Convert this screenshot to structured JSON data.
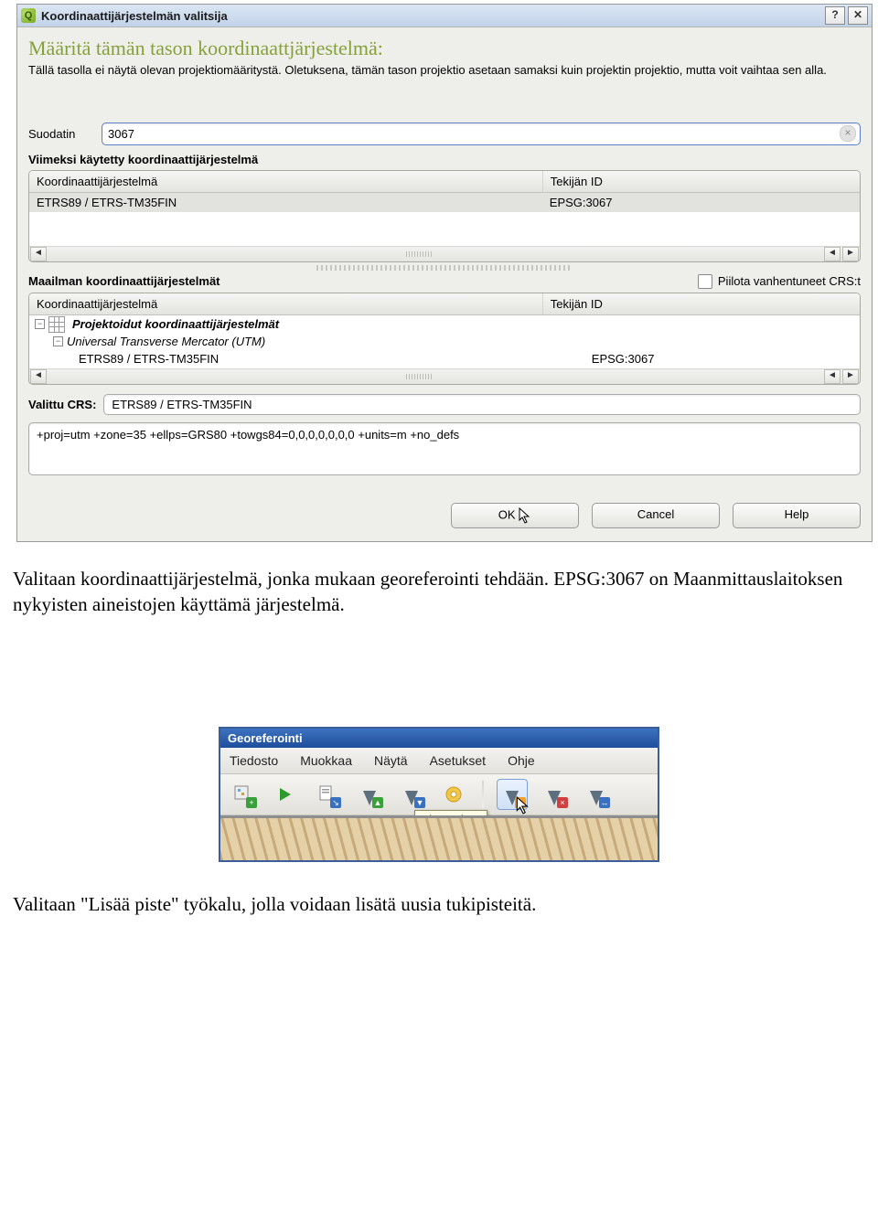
{
  "dialog": {
    "title": "Koordinaattijärjestelmän valitsija",
    "header_title": "Määritä tämän tason koordinaattjärjestelmä:",
    "header_desc": "Tällä tasolla ei näytä olevan projektiomääritystä. Oletuksena, tämän tason projektio asetaan samaksi kuin projektin projektio, mutta voit vaihtaa sen alla.",
    "filter_label": "Suodatin",
    "filter_value": "3067",
    "recent_label": "Viimeksi käytetty koordinaattijärjestelmä",
    "col_crs": "Koordinaattijärjestelmä",
    "col_id": "Tekijän ID",
    "recent_rows": [
      {
        "crs": "ETRS89 / ETRS-TM35FIN",
        "id": "EPSG:3067"
      }
    ],
    "world_label": "Maailman koordinaattijärjestelmät",
    "hide_dep_label": "Piilota vanhentuneet CRS:t",
    "tree": {
      "group1": "Projektoidut koordinaattijärjestelmät",
      "group2": "Universal Transverse Mercator (UTM)",
      "leaf_crs": "ETRS89 / ETRS-TM35FIN",
      "leaf_id": "EPSG:3067"
    },
    "selected_label": "Valittu CRS:",
    "selected_value": "ETRS89 / ETRS-TM35FIN",
    "proj_string": "+proj=utm +zone=35 +ellps=GRS80 +towgs84=0,0,0,0,0,0,0 +units=m +no_defs",
    "btn_ok": "OK",
    "btn_cancel": "Cancel",
    "btn_help": "Help"
  },
  "doc_para1": "Valitaan koordinaattijärjestelmä, jonka mukaan georeferointi tehdään.  EPSG:3067 on Maanmittauslaitoksen nykyisten aineistojen käyttämä järjestelmä.",
  "georef": {
    "title": "Georeferointi",
    "menu": {
      "file": "Tiedosto",
      "edit": "Muokkaa",
      "view": "Näytä",
      "settings": "Asetukset",
      "help": "Ohje"
    },
    "tooltip": "Lisää piste"
  },
  "doc_para2": "Valitaan \"Lisää piste\" työkalu, jolla voidaan lisätä uusia tukipisteitä."
}
